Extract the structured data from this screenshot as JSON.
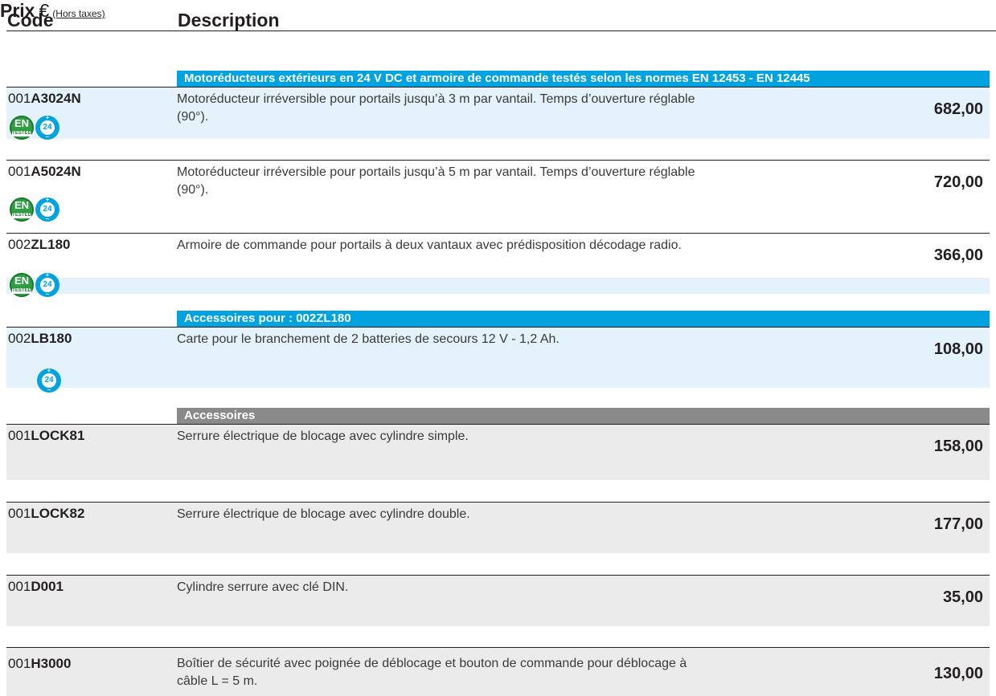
{
  "header": {
    "code_label": "Code",
    "description_label": "Description",
    "price_label": "Prix",
    "currency_symbol": "€",
    "tax_note": "(Hors taxes)"
  },
  "sections": [
    {
      "title": "Motoréducteurs extérieurs en 24 V DC et armoire de commande testés selon les normes EN 12453 - EN 12445",
      "color": "#00a3e0"
    },
    {
      "title": "Accessoires pour : 002ZL180",
      "color": "#00a3e0"
    },
    {
      "title": "Accessoires",
      "color": "#8a8a8a"
    }
  ],
  "icons": {
    "en_tested_top": "EN",
    "en_tested_bottom": "TESTED",
    "v24": "24"
  },
  "rows": [
    {
      "prefix": "001",
      "code": "A3024N",
      "description": "Motoréducteur irréversible pour portails jusqu’à 3 m par vantail. Temps d’ouverture réglable (90°).",
      "price": "682,00"
    },
    {
      "prefix": "001",
      "code": "A5024N",
      "description": "Motoréducteur irréversible pour portails jusqu’à 5 m par vantail. Temps d’ouverture réglable (90°).",
      "price": "720,00"
    },
    {
      "prefix": "002",
      "code": "ZL180",
      "description": "Armoire de commande pour portails à deux vantaux avec prédisposition décodage radio.",
      "price": "366,00"
    },
    {
      "prefix": "002",
      "code": "LB180",
      "description": "Carte pour le branchement de 2 batteries de secours 12 V - 1,2 Ah.",
      "price": "108,00"
    },
    {
      "prefix": "001",
      "code": "LOCK81",
      "description": "Serrure électrique de blocage avec cylindre simple.",
      "price": "158,00"
    },
    {
      "prefix": "001",
      "code": "LOCK82",
      "description": "Serrure électrique de blocage avec cylindre double.",
      "price": "177,00"
    },
    {
      "prefix": "001",
      "code": "D001",
      "description": "Cylindre serrure avec clé DIN.",
      "price": "35,00"
    },
    {
      "prefix": "001",
      "code": "H3000",
      "description": "Boîtier de sécurité avec poignée de déblocage et bouton de commande pour déblocage à câble L = 5 m.",
      "price": "130,00"
    }
  ]
}
